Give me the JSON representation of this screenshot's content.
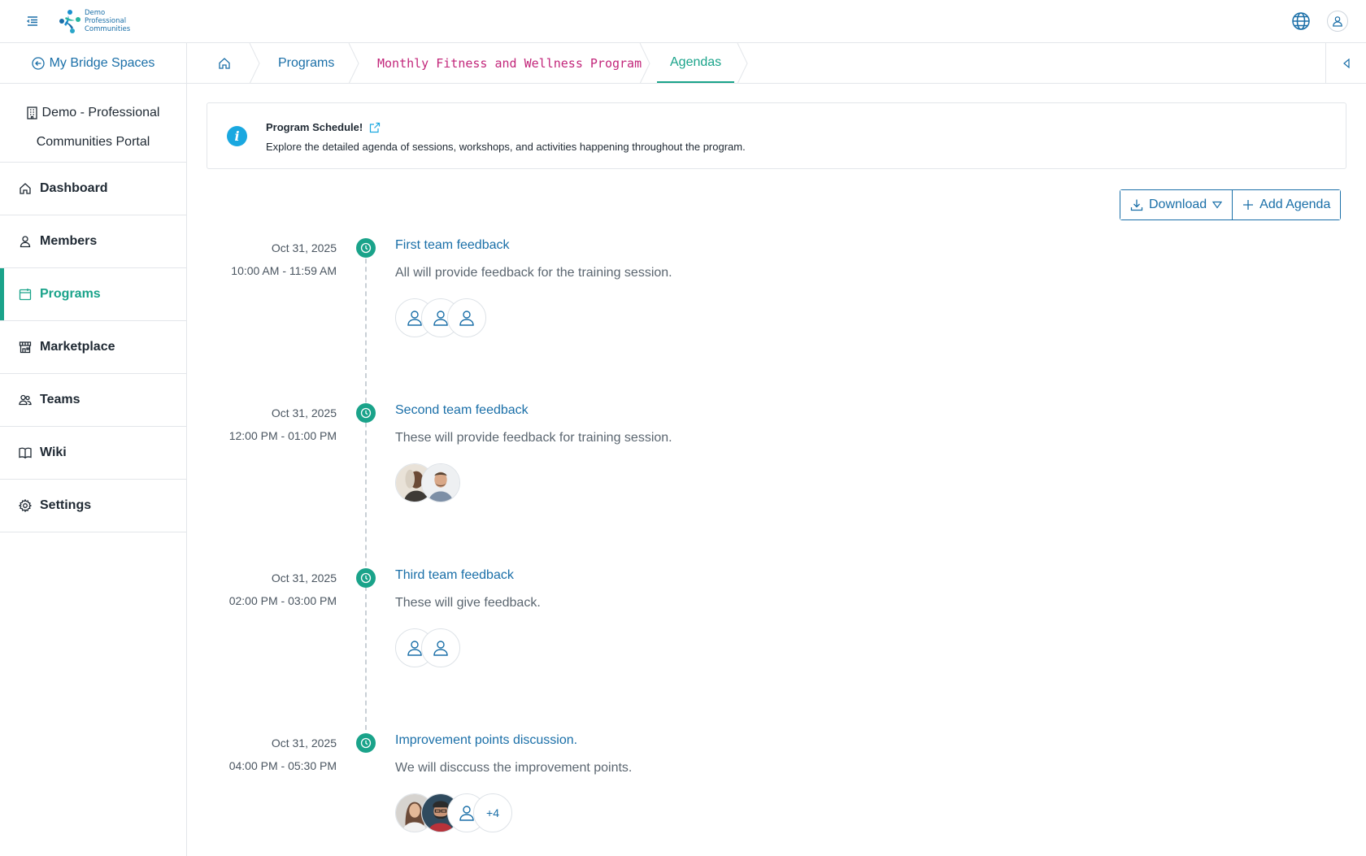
{
  "header": {
    "logo_lines": [
      "Demo",
      "Professional",
      "Communities"
    ]
  },
  "sidebar": {
    "back_label": "My Bridge Spaces",
    "org_line1": "Demo - Professional",
    "org_line2": "Communities Portal",
    "items": [
      {
        "label": "Dashboard",
        "icon": "home-icon"
      },
      {
        "label": "Members",
        "icon": "user-icon"
      },
      {
        "label": "Programs",
        "icon": "calendar-icon",
        "active": true
      },
      {
        "label": "Marketplace",
        "icon": "store-icon"
      },
      {
        "label": "Teams",
        "icon": "users-icon"
      },
      {
        "label": "Wiki",
        "icon": "book-icon"
      },
      {
        "label": "Settings",
        "icon": "gear-icon"
      }
    ]
  },
  "breadcrumb": {
    "programs": "Programs",
    "program": "Monthly Fitness and Wellness Program",
    "current": "Agendas"
  },
  "info": {
    "title": "Program Schedule!",
    "description": "Explore the detailed agenda of sessions, workshops, and activities happening throughout the program."
  },
  "toolbar": {
    "download_label": "Download",
    "add_label": "Add Agenda"
  },
  "agendas": [
    {
      "date": "Oct 31, 2025",
      "time": "10:00 AM - 11:59 AM",
      "title": "First team feedback",
      "description": "All will provide feedback for the training session."
    },
    {
      "date": "Oct 31, 2025",
      "time": "12:00 PM - 01:00 PM",
      "title": "Second team feedback",
      "description": "These will provide feedback for training session."
    },
    {
      "date": "Oct 31, 2025",
      "time": "02:00 PM - 03:00 PM",
      "title": "Third team feedback",
      "description": "These will give feedback."
    },
    {
      "date": "Oct 31, 2025",
      "time": "04:00 PM - 05:30 PM",
      "title": "Improvement points discussion.",
      "description": "We will disccuss the improvement points.",
      "more_count": "+4"
    }
  ],
  "colors": {
    "accent": "#1aa38a",
    "link": "#1a6fa8",
    "program_crumb": "#c2267a",
    "info": "#1aa8e0"
  }
}
